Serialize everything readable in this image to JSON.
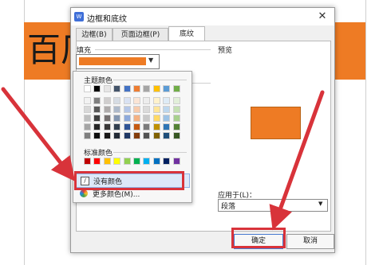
{
  "background_doc": {
    "big_char": "百厂"
  },
  "dialog": {
    "title": "边框和底纹",
    "close_symbol": "✕",
    "tabs": [
      {
        "label": "边框(B)"
      },
      {
        "label": "页面边框(P)"
      },
      {
        "label": "底纹"
      }
    ],
    "fill_label": "填充",
    "preview_label": "预览",
    "apply_to_label": "应用于(L)：",
    "apply_to_value": "段落",
    "ok_label": "确定",
    "cancel_label": "取消"
  },
  "color_popup": {
    "theme_label": "主题颜色",
    "standard_label": "标准颜色",
    "no_color_label": "没有颜色",
    "more_colors_label": "更多颜色(M)...",
    "theme_colors": [
      [
        "#ffffff",
        "#000000",
        "#e7e6e6",
        "#44546a",
        "#4472c4",
        "#ed7d31",
        "#a5a5a5",
        "#ffc000",
        "#5b9bd5",
        "#70ad47"
      ],
      [
        "#f2f2f2",
        "#7f7f7f",
        "#d0cece",
        "#d6dce4",
        "#d9e2f3",
        "#fbe5d5",
        "#ededed",
        "#fff2cc",
        "#deebf6",
        "#e2efd9"
      ],
      [
        "#d8d8d8",
        "#595959",
        "#aeabab",
        "#adb9ca",
        "#b4c6e7",
        "#f7cbac",
        "#dbdbdb",
        "#fee599",
        "#bdd7ee",
        "#c5e0b3"
      ],
      [
        "#bfbfbf",
        "#3f3f3f",
        "#757070",
        "#8496b0",
        "#8eaadb",
        "#f4b183",
        "#c9c9c9",
        "#ffd965",
        "#9dc3e6",
        "#a8d08d"
      ],
      [
        "#a5a5a5",
        "#262626",
        "#3a3838",
        "#323f4f",
        "#2f5496",
        "#c55a11",
        "#7b7b7b",
        "#bf9000",
        "#2e75b5",
        "#538135"
      ],
      [
        "#7f7f7f",
        "#0c0c0c",
        "#171616",
        "#222a35",
        "#1f3864",
        "#833c0b",
        "#525252",
        "#7f6000",
        "#1e4e79",
        "#375623"
      ]
    ],
    "standard_colors": [
      "#c00000",
      "#ff0000",
      "#ffc000",
      "#ffff00",
      "#92d050",
      "#00b050",
      "#00b0f0",
      "#0070c0",
      "#002060",
      "#7030a0"
    ]
  },
  "colors": {
    "accent_orange": "#ee7b24",
    "highlight_red": "#d8333a"
  }
}
